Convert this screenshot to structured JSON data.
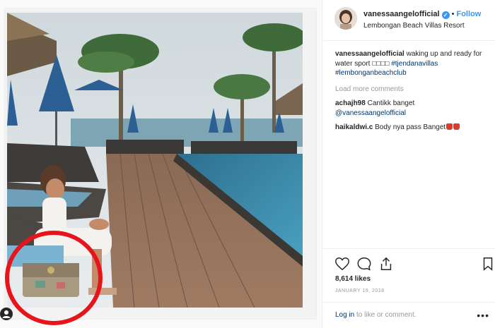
{
  "post": {
    "username": "vanessaangelofficial",
    "verified_glyph": "✓",
    "follow_label": "Follow",
    "location": "Lembongan Beach Villas Resort"
  },
  "caption": {
    "user": "vanessaangelofficial",
    "text_before": " waking up and ready for water sport ",
    "emoji_placeholder": "□□□□",
    "tag1": "#tjendanavillas",
    "tag2": "#lembonganbeachclub"
  },
  "load_more": "Load more comments",
  "comments": [
    {
      "user": "achajh98",
      "text": " Cantikk banget",
      "mention": "@vanessaangelofficial"
    },
    {
      "user": "haikaldwi.c",
      "text": " Body nya pass Banget"
    }
  ],
  "likes": "8,614 likes",
  "date": "JANUARY 19, 2018",
  "login": {
    "link": "Log in",
    "text": " to like or comment."
  },
  "more_dots": "•••",
  "colors": {
    "link": "#3897f0",
    "tag": "#003569",
    "highlight_circle": "#e8141c"
  }
}
